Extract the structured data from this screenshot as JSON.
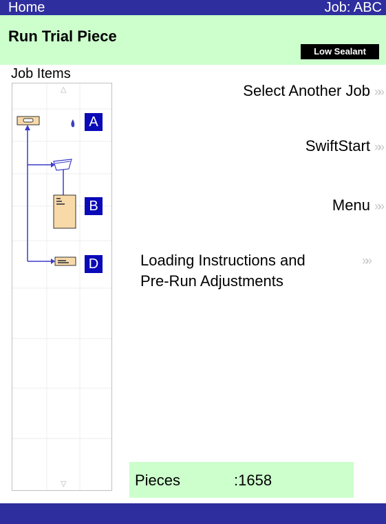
{
  "header": {
    "home_label": "Home",
    "job_label": "Job:  ABC"
  },
  "title": {
    "text": "Run Trial Piece",
    "badge": "Low Sealant"
  },
  "job_items": {
    "label": "Job Items",
    "letters": [
      "A",
      "B",
      "D"
    ],
    "scroll_up": "△",
    "scroll_down": "▽"
  },
  "actions": {
    "select_another_job": "Select Another Job",
    "swiftstart": "SwiftStart",
    "menu": "Menu",
    "loading_line1": "Loading Instructions and",
    "loading_line2": "Pre-Run Adjustments",
    "chevron": "»»"
  },
  "pieces": {
    "label": "Pieces",
    "value": ":1658"
  },
  "colors": {
    "nav_bar": "#2e2e9e",
    "title_bg": "#ccffcc",
    "letter_bg": "#0a0ab8"
  }
}
